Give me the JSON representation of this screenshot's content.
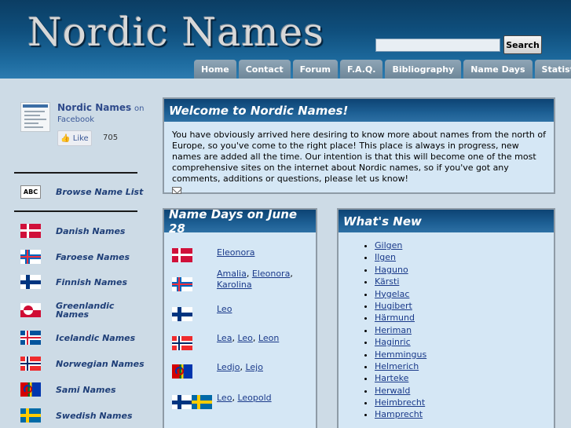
{
  "site": {
    "logo": "Nordic Names"
  },
  "search": {
    "placeholder": "",
    "button": "Search"
  },
  "nav": [
    "Home",
    "Contact",
    "Forum",
    "F.A.Q.",
    "Bibliography",
    "Name Days",
    "Statistics"
  ],
  "facebook": {
    "title": "Nordic Names",
    "on": "on",
    "platform": "Facebook",
    "like": "Like",
    "count": "705"
  },
  "sidebar": {
    "browse": "Browse Name List",
    "abc": "ABC",
    "items": [
      {
        "label": "Danish Names",
        "flag": "denmark"
      },
      {
        "label": "Faroese Names",
        "flag": "faroe"
      },
      {
        "label": "Finnish Names",
        "flag": "finland"
      },
      {
        "label": "Greenlandic Names",
        "flag": "greenland"
      },
      {
        "label": "Icelandic Names",
        "flag": "iceland"
      },
      {
        "label": "Norwegian Names",
        "flag": "norway"
      },
      {
        "label": "Sami Names",
        "flag": "sami"
      },
      {
        "label": "Swedish Names",
        "flag": "sweden"
      }
    ]
  },
  "welcome": {
    "title": "Welcome to Nordic Names!",
    "text": "You have obviously arrived here desiring to know more about names from the north of Europe, so you've come to the right place! This place is always in progress, new names are added all the time. Our intention is that this will become one of the most comprehensive sites on the internet about Nordic names, so if you've got any comments, additions or questions, please let us know!"
  },
  "namedays": {
    "title": "Name Days on June 28",
    "rows": [
      {
        "flags": [
          "denmark"
        ],
        "names": [
          "Eleonora"
        ]
      },
      {
        "flags": [
          "faroe"
        ],
        "names": [
          "Amalia",
          "Eleonora",
          "Karolina"
        ]
      },
      {
        "flags": [
          "finland"
        ],
        "names": [
          "Leo"
        ]
      },
      {
        "flags": [
          "norway"
        ],
        "names": [
          "Lea",
          "Leo",
          "Leon"
        ]
      },
      {
        "flags": [
          "sami"
        ],
        "names": [
          "Ledjo",
          "Lejo"
        ]
      },
      {
        "flags": [
          "finland",
          "sweden"
        ],
        "names": [
          "Leo",
          "Leopold"
        ]
      }
    ]
  },
  "whatsnew": {
    "title": "What's New",
    "items": [
      "Gilgen",
      "Ilgen",
      "Haguno",
      "Kärsti",
      "Hygelac",
      "Hugibert",
      "Härmund",
      "Heriman",
      "Haginric",
      "Hemmingus",
      "Helmerich",
      "Harteke",
      "Herwald",
      "Heimbrecht",
      "Hamprecht"
    ]
  },
  "colors": {
    "header": "#0f4f7d",
    "panel_bg": "#d5e7f5",
    "link": "#1a3a8a",
    "sidebar_link": "#1f3f78"
  }
}
